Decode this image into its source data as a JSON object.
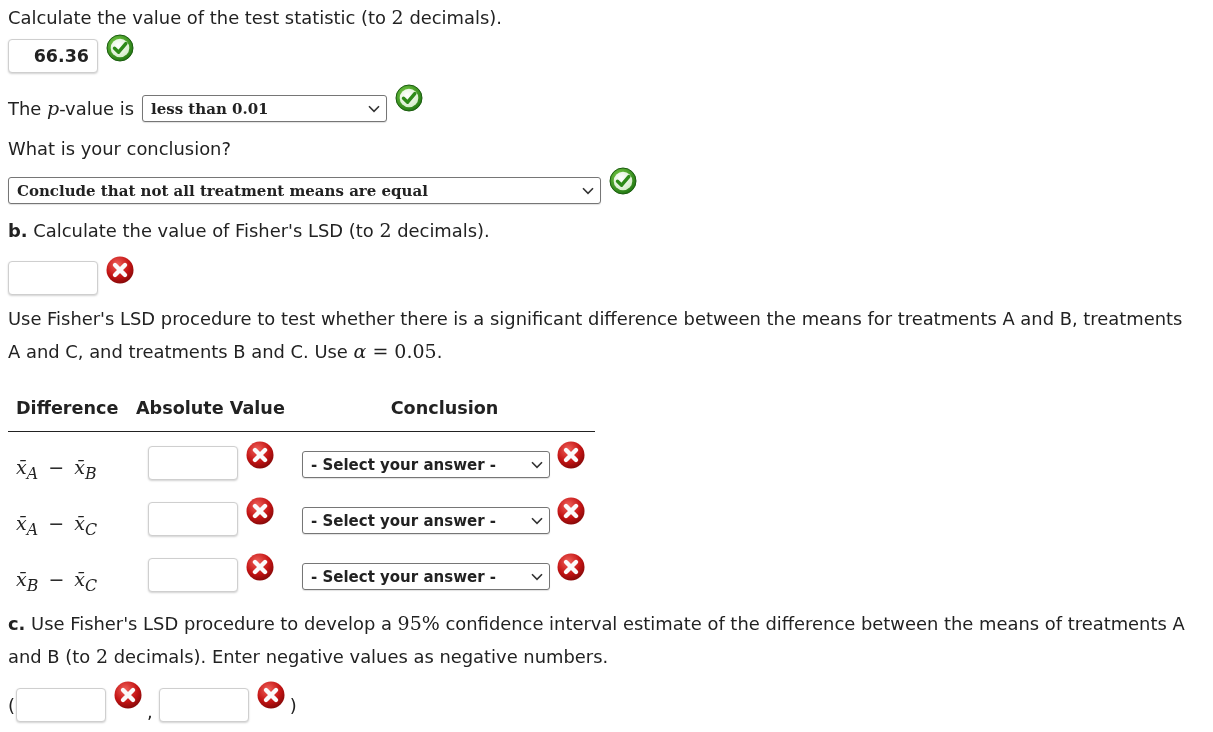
{
  "part_a": {
    "statistic_prompt": [
      {
        "kind": "text",
        "text": "Calculate the value of the test statistic (to "
      },
      {
        "kind": "num",
        "text": "2"
      },
      {
        "kind": "text",
        "text": " decimals)."
      }
    ],
    "statistic_answer": {
      "value": "66.36",
      "correct": true
    },
    "p_value_label": [
      {
        "kind": "text",
        "text": "The "
      },
      {
        "kind": "var",
        "text": "p"
      },
      {
        "kind": "text",
        "text": "-value is"
      }
    ],
    "p_value_answer": {
      "value": "less than 0.01",
      "correct": true
    },
    "conclusion_prompt": "What is your conclusion?",
    "conclusion_answer": {
      "value": "Conclude that not all treatment means are equal",
      "correct": true
    }
  },
  "part_b": {
    "prompt": [
      {
        "kind": "bold",
        "text": "b."
      },
      {
        "kind": "text",
        "text": " Calculate the value of Fisher's LSD (to "
      },
      {
        "kind": "num",
        "text": "2"
      },
      {
        "kind": "text",
        "text": " decimals)."
      }
    ],
    "lsd_answer": {
      "correct": false
    },
    "instructions": [
      {
        "kind": "text",
        "text": "Use Fisher's LSD procedure to test whether there is a significant difference between the means for treatments A and B, treatments A and C, and treatments B and C. Use "
      },
      {
        "kind": "var",
        "text": "α"
      },
      {
        "kind": "num",
        "text": " = 0.05"
      },
      {
        "kind": "text",
        "text": "."
      }
    ],
    "table": {
      "columns": [
        "Difference",
        "Absolute Value",
        "Conclusion"
      ],
      "rows": [
        {
          "difference": "x̄$_{A}$ − x̄$_{B}$",
          "absolute_value": {
            "correct": false
          },
          "conclusion": {
            "placeholder": "- Select your answer -",
            "correct": false
          }
        },
        {
          "difference": "x̄$_{A}$ − x̄$_{C}$",
          "absolute_value": {
            "correct": false
          },
          "conclusion": {
            "placeholder": "- Select your answer -",
            "correct": false
          }
        },
        {
          "difference": "x̄$_{B}$ − x̄$_{C}$",
          "absolute_value": {
            "correct": false
          },
          "conclusion": {
            "placeholder": "- Select your answer -",
            "correct": false
          }
        }
      ]
    }
  },
  "part_c": {
    "prompt": [
      {
        "kind": "bold",
        "text": "c."
      },
      {
        "kind": "text",
        "text": " Use Fisher's LSD procedure to develop a "
      },
      {
        "kind": "num",
        "text": "95%"
      },
      {
        "kind": "text",
        "text": " confidence interval estimate of the difference between the means of treatments A and B (to "
      },
      {
        "kind": "num",
        "text": "2"
      },
      {
        "kind": "text",
        "text": " decimals). Enter negative values as negative numbers."
      }
    ],
    "interval": {
      "open": "(",
      "lower": {
        "correct": false
      },
      "separator": ",",
      "upper": {
        "correct": false
      },
      "close": ")"
    }
  }
}
